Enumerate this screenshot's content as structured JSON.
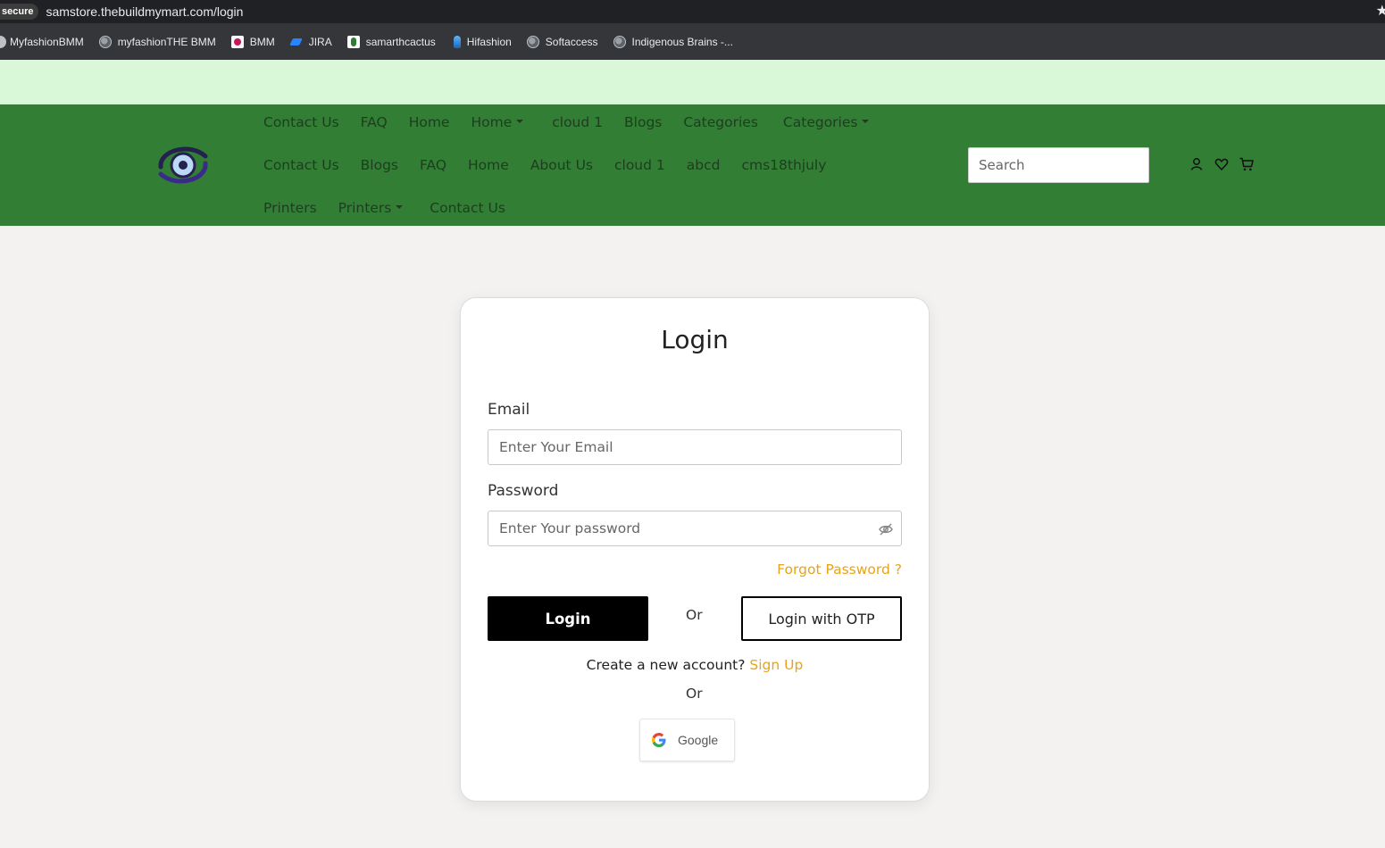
{
  "browser": {
    "secure_label": "secure",
    "url": "samstore.thebuildmymart.com/login",
    "bookmarks": [
      {
        "label": "MyfashionBMM",
        "icon": "half-globe-icon"
      },
      {
        "label": "myfashionTHE BMM",
        "icon": "globe-icon"
      },
      {
        "label": "BMM",
        "icon": "bmm-icon"
      },
      {
        "label": "JIRA",
        "icon": "jira-icon"
      },
      {
        "label": "samarthcactus",
        "icon": "cactus-icon"
      },
      {
        "label": "Hifashion",
        "icon": "hifashion-icon"
      },
      {
        "label": "Softaccess",
        "icon": "globe-icon"
      },
      {
        "label": "Indigenous Brains -...",
        "icon": "globe-icon"
      }
    ]
  },
  "header": {
    "nav_row1": [
      "Contact Us",
      "FAQ",
      "Home",
      "Home",
      "cloud 1",
      "Blogs",
      "Categories",
      "Categories"
    ],
    "nav_row2": [
      "Contact Us",
      "Blogs",
      "FAQ",
      "Home",
      "About Us",
      "cloud 1",
      "abcd",
      "cms18thjuly"
    ],
    "nav_row3": [
      "Printers",
      "Printers",
      "Contact Us"
    ],
    "search_placeholder": "Search",
    "colors": {
      "header_bg": "#327e34",
      "top_strip": "#d8f8d8",
      "accent": "#e8a317"
    }
  },
  "login": {
    "title": "Login",
    "email_label": "Email",
    "email_placeholder": "Enter Your Email",
    "password_label": "Password",
    "password_placeholder": "Enter Your password",
    "forgot_label": "Forgot Password ?",
    "login_button": "Login",
    "or_text": "Or",
    "otp_button": "Login with OTP",
    "signup_prompt": "Create a new account?",
    "signup_link": "Sign Up",
    "or_text_2": "Or",
    "google_label": "Google"
  }
}
